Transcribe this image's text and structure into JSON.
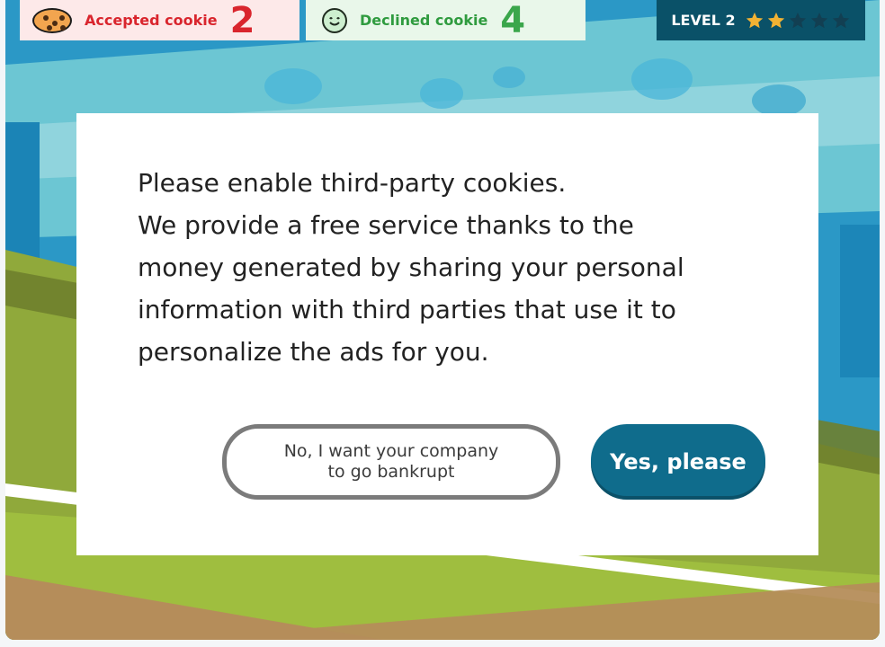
{
  "hud": {
    "accepted": {
      "label": "Accepted cookie",
      "count": "2",
      "icon": "cookie-icon",
      "color": "#d9252d"
    },
    "declined": {
      "label": "Declined cookie",
      "count": "4",
      "icon": "smile-icon",
      "color": "#2f9b3f"
    },
    "level": {
      "label": "LEVEL 2",
      "stars_filled": 2,
      "stars_total": 5
    }
  },
  "modal": {
    "message": "Please enable third-party cookies.\nWe provide a free service thanks to the\nmoney generated by sharing your personal\ninformation with third parties that use it to\npersonalize the ads for you.",
    "decline_button": "No, I want your company\nto go bankrupt",
    "accept_button": "Yes, please"
  },
  "colors": {
    "accent": "#0f6c8c",
    "hud_bg": "#0a5168",
    "star_filled": "#f2b233",
    "star_empty": "#123f52"
  }
}
